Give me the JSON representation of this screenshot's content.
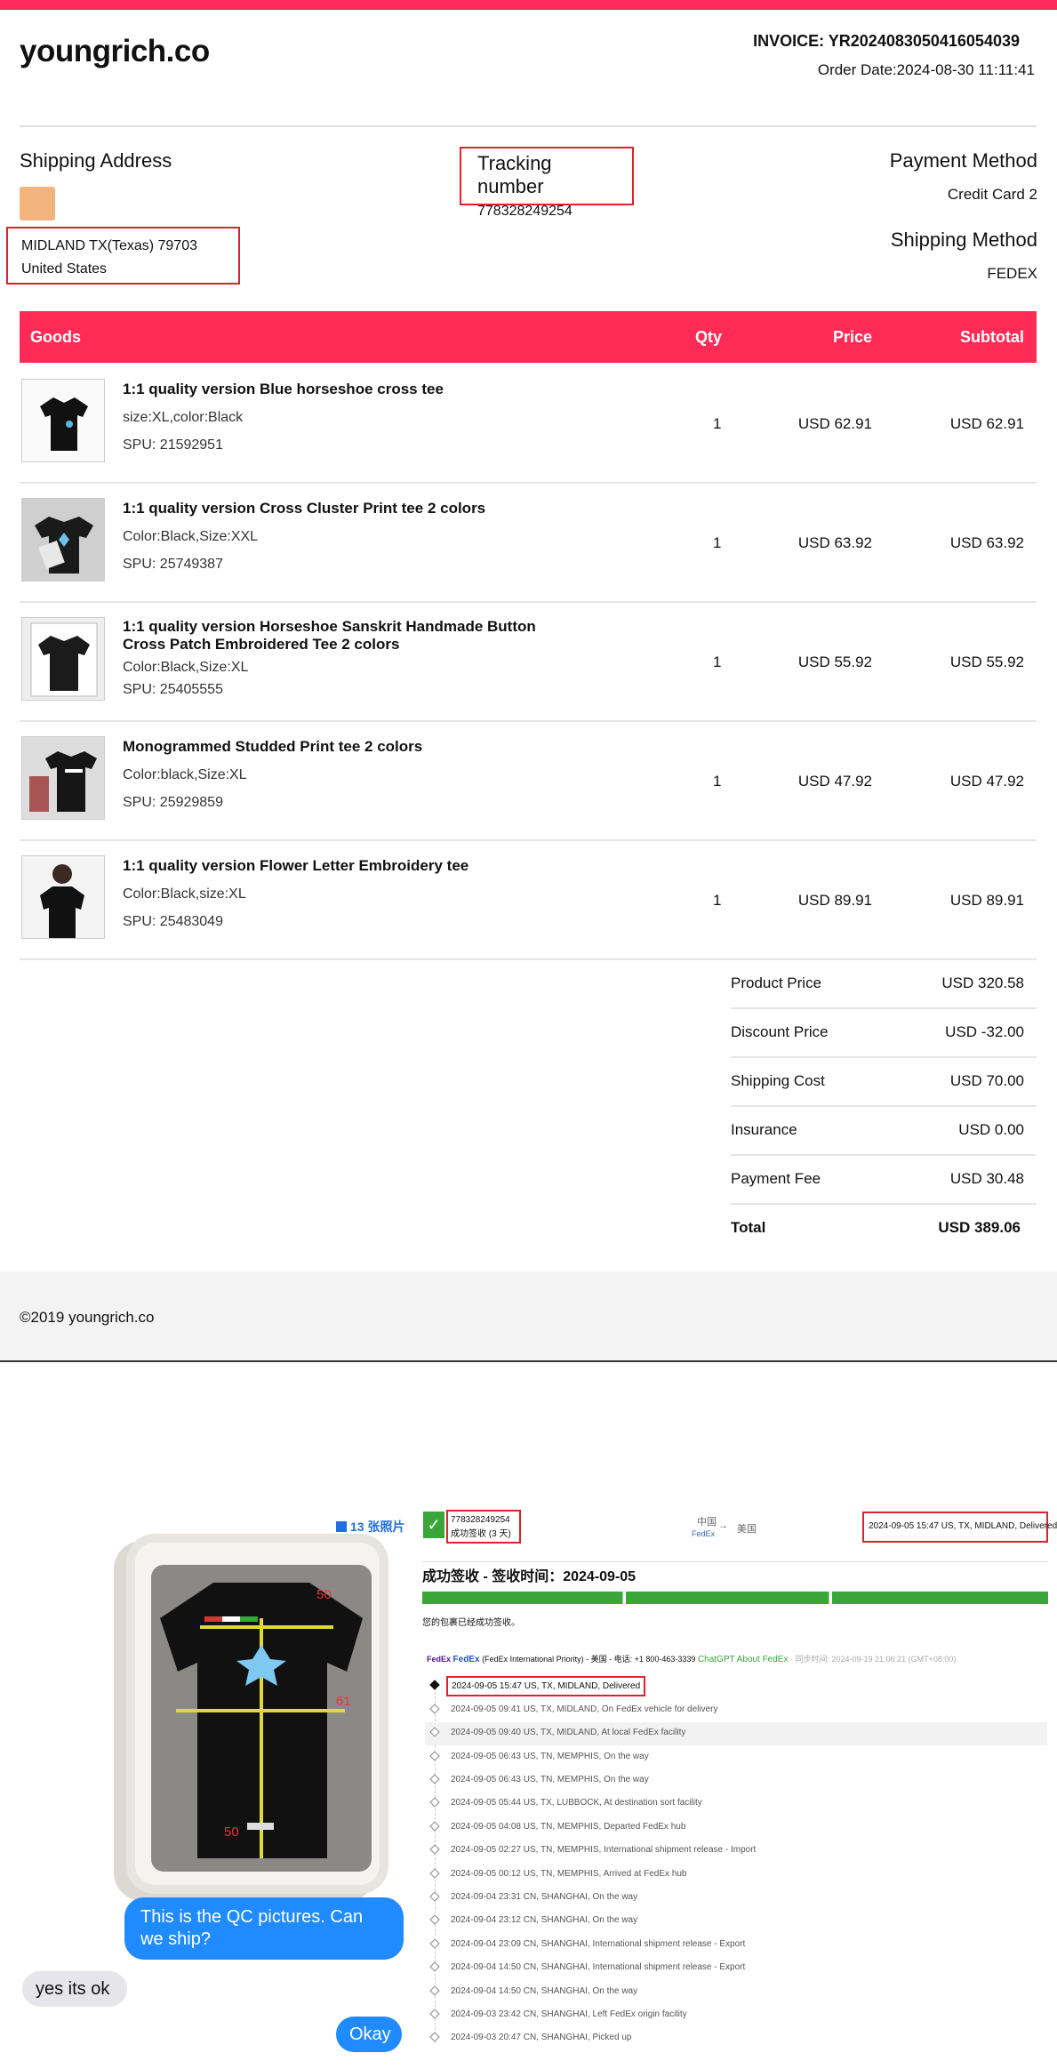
{
  "invoice": {
    "brand": "youngrich.co",
    "invoice_no": "INVOICE:  YR2024083050416054039",
    "order_date": "Order Date:2024-08-30 11:11:41",
    "shipping_address_label": "Shipping Address",
    "address_line1": "MIDLAND TX(Texas) 79703",
    "address_line2": "United States",
    "tracking_label": "Tracking number",
    "tracking_number": "778328249254",
    "payment_method_label": "Payment Method",
    "payment_method": "Credit Card 2",
    "shipping_method_label": "Shipping Method",
    "shipping_method": "FEDEX"
  },
  "table": {
    "headers": {
      "goods": "Goods",
      "qty": "Qty",
      "price": "Price",
      "subtotal": "Subtotal"
    },
    "items": [
      {
        "name": "1:1 quality version Blue horseshoe cross tee",
        "attrs": "size:XL,color:Black",
        "spu": "SPU: 21592951",
        "qty": "1",
        "price": "USD 62.91",
        "subtotal": "USD 62.91"
      },
      {
        "name": "1:1 quality version Cross Cluster Print tee 2 colors",
        "attrs": "Color:Black,Size:XXL",
        "spu": "SPU: 25749387",
        "qty": "1",
        "price": "USD 63.92",
        "subtotal": "USD 63.92"
      },
      {
        "name": "1:1 quality version Horseshoe Sanskrit Handmade Button Cross Patch Embroidered Tee 2 colors",
        "attrs": "Color:Black,Size:XL",
        "spu": "SPU: 25405555",
        "qty": "1",
        "price": "USD 55.92",
        "subtotal": "USD 55.92"
      },
      {
        "name": "Monogrammed Studded Print tee 2 colors",
        "attrs": "Color:black,Size:XL",
        "spu": "SPU: 25929859",
        "qty": "1",
        "price": "USD 47.92",
        "subtotal": "USD 47.92"
      },
      {
        "name": "1:1 quality version Flower Letter Embroidery tee",
        "attrs": "Color:Black,size:XL",
        "spu": "SPU: 25483049",
        "qty": "1",
        "price": "USD 89.91",
        "subtotal": "USD 89.91"
      }
    ]
  },
  "summary": [
    {
      "label": "Product Price",
      "value": "USD 320.58"
    },
    {
      "label": "Discount Price",
      "value": "USD -32.00"
    },
    {
      "label": "Shipping Cost",
      "value": "USD 70.00"
    },
    {
      "label": "Insurance",
      "value": "USD 0.00"
    },
    {
      "label": "Payment Fee",
      "value": "USD 30.48"
    },
    {
      "label": "Total",
      "value": "USD 389.06"
    }
  ],
  "footer": {
    "copyright": "©2019 youngrich.co"
  },
  "chat": {
    "photos_label": "13 张照片",
    "measure_top": "50",
    "measure_right": "61",
    "measure_bottom": "50",
    "msg1": "This is the QC pictures. Can we ship?",
    "msg2": "yes its  ok",
    "msg3": "Okay"
  },
  "fedex": {
    "tracking": "778328249254",
    "status_small": "成功签收 (3 天)",
    "origin": "中国",
    "dest": "美国",
    "carrier_small": "FedEx",
    "latest": "2024-09-05 15:47  US, TX, MIDLAND, Delivered",
    "headline": "成功签收 - 签收时间：2024-09-05",
    "notice": "您的包裹已经成功签收。",
    "carrier_logo": "FedEx",
    "carrier_name": "FedEx",
    "carrier_info": "(FedEx International Priority) - 美国 - 电话: +1 800-463-3339",
    "chatgpt": "ChatGPT About FedEx",
    "updated": "· 同步时间: 2024-09-19 21:06:21 (GMT+08:00)",
    "events": [
      "2024-09-05 15:47  US, TX, MIDLAND, Delivered",
      "2024-09-05 09:41  US, TX, MIDLAND, On FedEx vehicle for delivery",
      "2024-09-05 09:40  US, TX, MIDLAND, At local FedEx facility",
      "2024-09-05 06:43  US, TN, MEMPHIS, On the way",
      "2024-09-05 06:43  US, TN, MEMPHIS, On the way",
      "2024-09-05 05:44  US, TX, LUBBOCK, At destination sort facility",
      "2024-09-05 04:08  US, TN, MEMPHIS, Departed FedEx hub",
      "2024-09-05 02:27  US, TN, MEMPHIS, International shipment release - Import",
      "2024-09-05 00:12  US, TN, MEMPHIS, Arrived at FedEx hub",
      "2024-09-04 23:31  CN, SHANGHAI, On the way",
      "2024-09-04 23:12  CN, SHANGHAI, On the way",
      "2024-09-04 23:09  CN, SHANGHAI, International shipment release - Export",
      "2024-09-04 14:50  CN, SHANGHAI, International shipment release - Export",
      "2024-09-04 14:50  CN, SHANGHAI, On the way",
      "2024-09-03 23:42  CN, SHANGHAI, Left FedEx origin facility",
      "2024-09-03 20:47  CN, SHANGHAI, Picked up"
    ]
  },
  "colors": {
    "accent": "#ff2a5c",
    "highlight": "#e0202a",
    "fedex_green": "#3aa63a",
    "imessage_blue": "#1f8bff"
  }
}
